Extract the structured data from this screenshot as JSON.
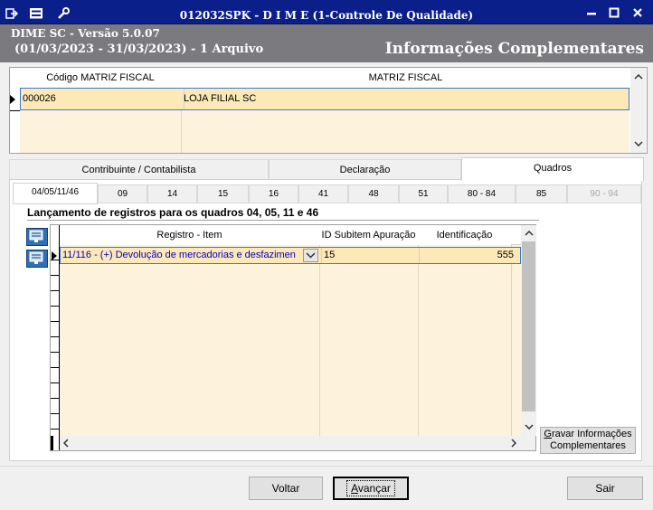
{
  "window": {
    "title": "012032SPK - D I M E (1-Controle De Qualidade)",
    "icons": [
      "export-icon",
      "menu-icon",
      "wrench-icon"
    ],
    "controls": [
      "minimize",
      "maximize",
      "close"
    ]
  },
  "header": {
    "version": "DIME SC - Versão 5.0.07",
    "period": "(01/03/2023 - 31/03/2023) - 1 Arquivo",
    "section_title": "Informações Complementares"
  },
  "top_grid": {
    "columns": [
      "Código MATRIZ FISCAL",
      "MATRIZ FISCAL"
    ],
    "rows": [
      {
        "codigo": "000026",
        "matriz": "LOJA FILIAL SC"
      }
    ]
  },
  "main_tabs": [
    {
      "label": "Contribuinte / Contabilista",
      "active": false
    },
    {
      "label": "Declaração",
      "active": false
    },
    {
      "label": "Quadros",
      "active": true
    }
  ],
  "sub_tabs": [
    {
      "label": "04/05/11/46",
      "active": true,
      "enabled": true
    },
    {
      "label": "09",
      "active": false,
      "enabled": true
    },
    {
      "label": "14",
      "active": false,
      "enabled": true
    },
    {
      "label": "15",
      "active": false,
      "enabled": true
    },
    {
      "label": "16",
      "active": false,
      "enabled": true
    },
    {
      "label": "41",
      "active": false,
      "enabled": true
    },
    {
      "label": "48",
      "active": false,
      "enabled": true
    },
    {
      "label": "51",
      "active": false,
      "enabled": true
    },
    {
      "label": "80 - 84",
      "active": false,
      "enabled": true
    },
    {
      "label": "85",
      "active": false,
      "enabled": true
    },
    {
      "label": "90 - 94",
      "active": false,
      "enabled": false
    }
  ],
  "quadros_section": {
    "title": "Lançamento de registros para os quadros 04, 05, 11 e 46",
    "columns": [
      "Registro - Item",
      "ID Subitem Apuração",
      "Identificação"
    ],
    "rows": [
      {
        "registro": "11/116 - (+) Devolução de mercadorias e desfazimen",
        "id_subitem": "15",
        "identificacao": "555"
      }
    ]
  },
  "buttons": {
    "gravar": "Gravar Informações Complementares",
    "gravar_line1": "Gravar Informações",
    "gravar_line2": "Complementares",
    "voltar": "Voltar",
    "avancar": "Avançar",
    "sair": "Sair"
  },
  "colors": {
    "title_bar": "#0b1f8a",
    "header_band": "#7b7b7f",
    "selected_row": "#fde8b8",
    "link_text": "#0000cc"
  }
}
